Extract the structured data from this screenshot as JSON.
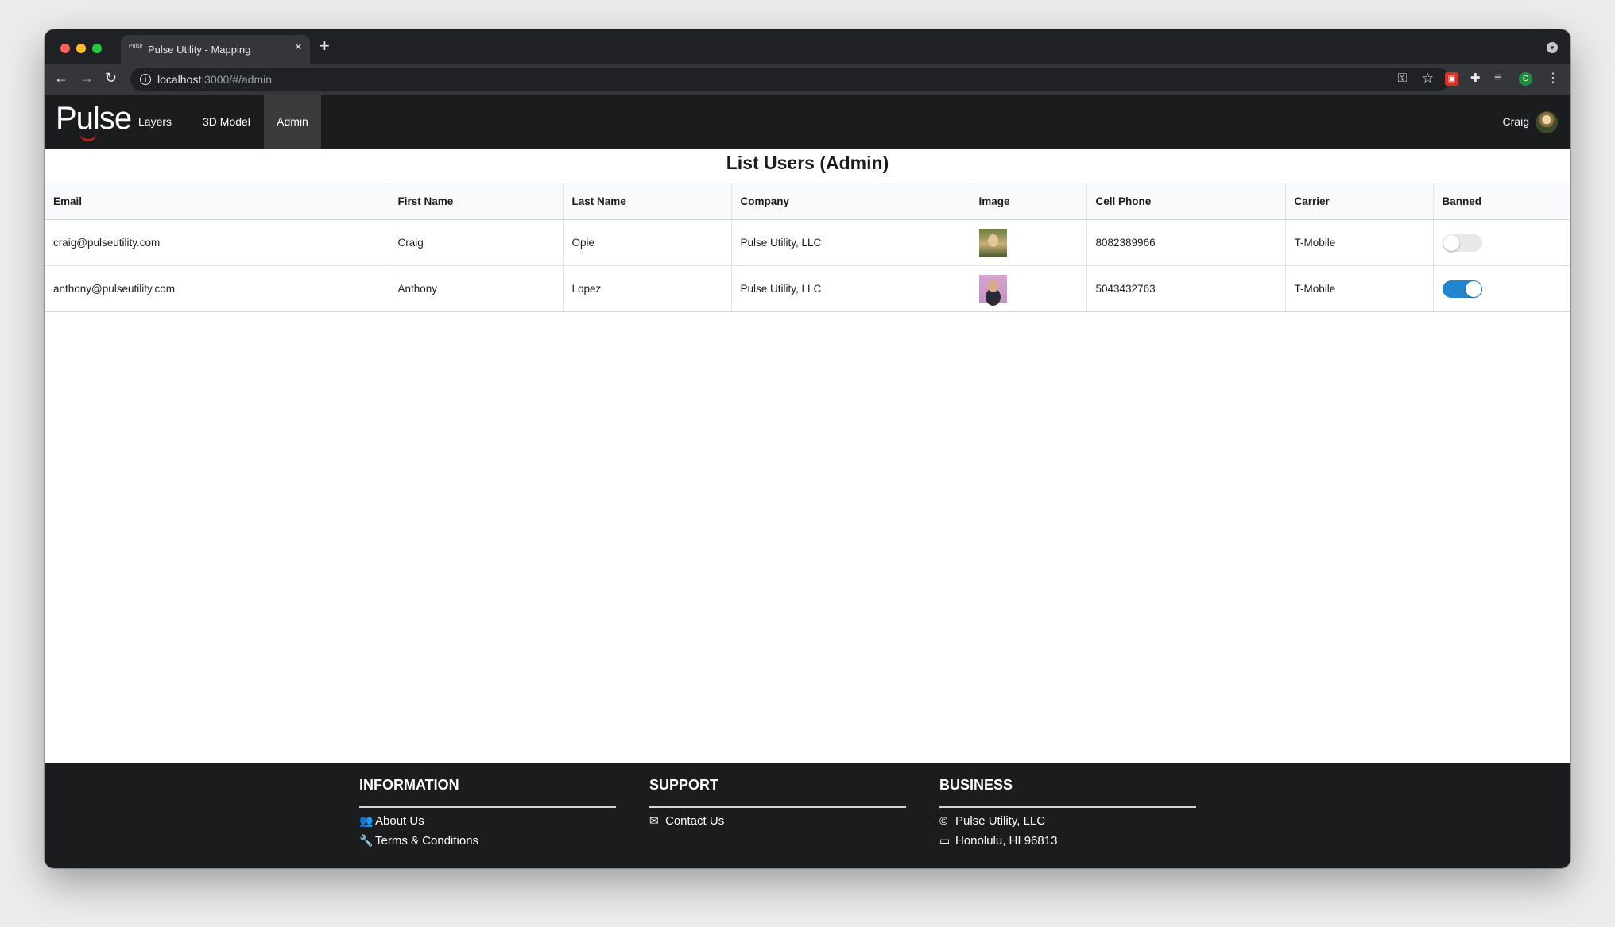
{
  "browser": {
    "tab_title": "Pulse Utility - Mapping",
    "tab_favicon_text": "Pulse",
    "url_host": "localhost",
    "url_rest": ":3000/#/admin",
    "profile_initial": "C"
  },
  "nav": {
    "logo_text": "Pulse",
    "items": [
      {
        "label": "Layers"
      },
      {
        "label": "3D Model"
      },
      {
        "label": "Admin",
        "active": true
      }
    ],
    "user_name": "Craig"
  },
  "page": {
    "title": "List Users (Admin)"
  },
  "table": {
    "columns": [
      "Email",
      "First Name",
      "Last Name",
      "Company",
      "Image",
      "Cell Phone",
      "Carrier",
      "Banned"
    ],
    "rows": [
      {
        "email": "craig@pulseutility.com",
        "first_name": "Craig",
        "last_name": "Opie",
        "company": "Pulse Utility, LLC",
        "image": "craig-photo",
        "cell_phone": "8082389966",
        "carrier": "T-Mobile",
        "banned": false
      },
      {
        "email": "anthony@pulseutility.com",
        "first_name": "Anthony",
        "last_name": "Lopez",
        "company": "Pulse Utility, LLC",
        "image": "anthony-photo",
        "cell_phone": "5043432763",
        "carrier": "T-Mobile",
        "banned": true
      }
    ]
  },
  "footer": {
    "information": {
      "heading": "INFORMATION",
      "about": "About Us",
      "terms": "Terms & Conditions"
    },
    "support": {
      "heading": "SUPPORT",
      "contact": "Contact Us"
    },
    "business": {
      "heading": "BUSINESS",
      "name": "Pulse Utility, LLC",
      "address": "Honolulu, HI 96813"
    }
  },
  "colors": {
    "toggle_on": "#2185d0",
    "navbar_bg": "#1b1c1d",
    "logo_accent": "#d01919"
  }
}
